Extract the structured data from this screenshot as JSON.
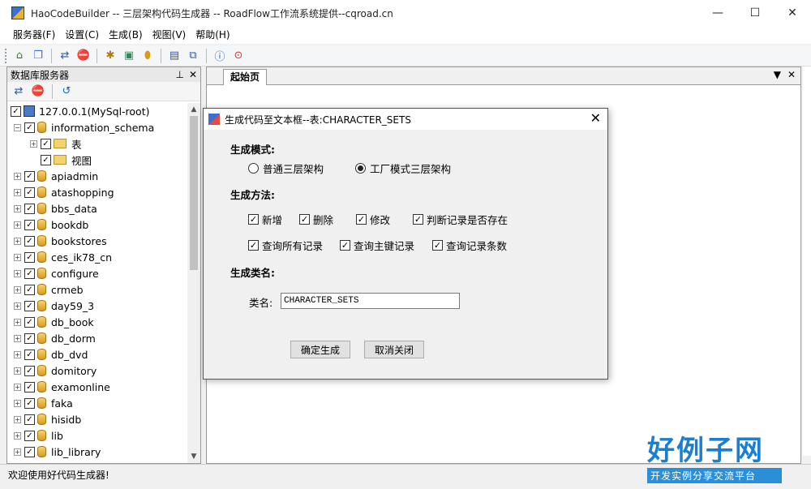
{
  "window": {
    "title": "HaoCodeBuilder -- 三层架构代码生成器 -- RoadFlow工作流系统提供--cqroad.cn",
    "minimize": "—",
    "maximize": "☐",
    "close": "✕"
  },
  "menu": {
    "items": [
      "服务器(F)",
      "设置(C)",
      "生成(B)",
      "视图(V)",
      "帮助(H)"
    ]
  },
  "toolbar": {
    "icons": [
      "home-icon",
      "copy-icon",
      "connect-icon",
      "stop-icon",
      "tools-icon",
      "image-icon",
      "database-icon",
      "window-icon",
      "window-cascade-icon",
      "info-icon",
      "help-icon"
    ]
  },
  "left_panel": {
    "title": "数据库服务器",
    "pin": "ᅳ",
    "close": "✕",
    "server": "127.0.0.1(MySql-root)",
    "schema": "information_schema",
    "schema_children": [
      "表",
      "视图"
    ],
    "databases": [
      "apiadmin",
      "atashopping",
      "bbs_data",
      "bookdb",
      "bookstores",
      "ces_ik78_cn",
      "configure",
      "crmeb",
      "day59_3",
      "db_book",
      "db_dorm",
      "db_dvd",
      "domitory",
      "examonline",
      "faka",
      "hisidb",
      "lib",
      "lib_library"
    ]
  },
  "doc": {
    "tab": "起始页",
    "dropdown": "▼",
    "close": "✕"
  },
  "dialog": {
    "title": "生成代码至文本框--表:CHARACTER_SETS",
    "close": "✕",
    "mode_label": "生成模式:",
    "mode_options": [
      "普通三层架构",
      "工厂模式三层架构"
    ],
    "mode_selected": 1,
    "method_label": "生成方法:",
    "methods_row1": [
      "新增",
      "删除",
      "修改",
      "判断记录是否存在"
    ],
    "methods_row2": [
      "查询所有记录",
      "查询主键记录",
      "查询记录条数"
    ],
    "classname_section": "生成类名:",
    "classname_label": "类名:",
    "classname_value": "CHARACTER_SETS",
    "ok_button": "确定生成",
    "cancel_button": "取消关闭"
  },
  "status": {
    "text": "欢迎使用好代码生成器!"
  },
  "logo": {
    "main": "好例子网",
    "sub": "开发实例分享交流平台"
  }
}
